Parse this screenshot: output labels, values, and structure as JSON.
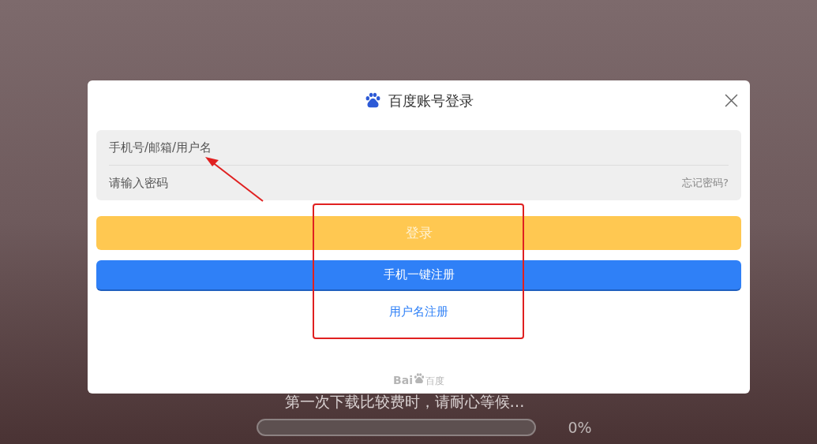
{
  "dialog": {
    "title": "百度账号登录",
    "account_field": {
      "placeholder": "手机号/邮箱/用户名"
    },
    "password_field": {
      "placeholder": "请输入密码"
    },
    "forgot_link": "忘记密码?",
    "login_button": {
      "label": "登录",
      "disabled": true
    },
    "phone_register_button": "手机一键注册",
    "username_register_link": "用户名注册",
    "footer_logo": {
      "latin": "Bai",
      "chinese": "百度"
    }
  },
  "loading": {
    "message": "第一次下载比较费时，请耐心等候…",
    "progress": {
      "level": 0,
      "reading": "0%"
    }
  }
}
